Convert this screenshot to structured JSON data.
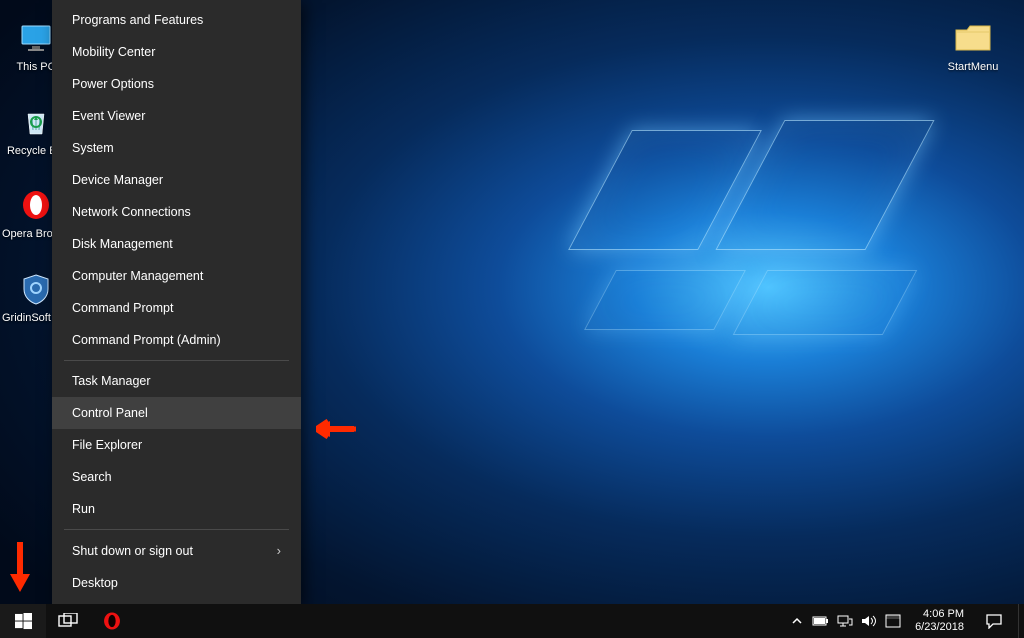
{
  "desktop": {
    "icons_left": [
      {
        "name": "this-pc-icon",
        "label": "This PC",
        "glyph": "pc"
      },
      {
        "name": "recycle-bin-icon",
        "label": "Recycle Bin",
        "glyph": "bin"
      },
      {
        "name": "opera-icon",
        "label": "Opera Browser",
        "glyph": "opera"
      },
      {
        "name": "gridinsoft-icon",
        "label": "GridinSoft Anti-Malware",
        "glyph": "shield"
      }
    ],
    "icons_right": [
      {
        "name": "startmenu-folder-icon",
        "label": "StartMenu",
        "glyph": "folder"
      }
    ]
  },
  "winx_menu": {
    "highlighted": "Control Panel",
    "sections": [
      [
        "Programs and Features",
        "Mobility Center",
        "Power Options",
        "Event Viewer",
        "System",
        "Device Manager",
        "Network Connections",
        "Disk Management",
        "Computer Management",
        "Command Prompt",
        "Command Prompt (Admin)"
      ],
      [
        "Task Manager",
        "Control Panel",
        "File Explorer",
        "Search",
        "Run"
      ],
      [
        {
          "label": "Shut down or sign out",
          "submenu": true
        },
        "Desktop"
      ]
    ]
  },
  "taskbar": {
    "pinned": [
      {
        "name": "task-view-button",
        "glyph": "taskview"
      },
      {
        "name": "opera-taskbar-icon",
        "glyph": "opera"
      }
    ],
    "tray": {
      "icons": [
        {
          "name": "tray-chevron-up-icon",
          "glyph": "chevup"
        },
        {
          "name": "battery-icon",
          "glyph": "battery"
        },
        {
          "name": "network-icon",
          "glyph": "network"
        },
        {
          "name": "volume-icon",
          "glyph": "volume"
        },
        {
          "name": "language-indicator",
          "glyph": "lang"
        }
      ],
      "time": "4:06 PM",
      "date": "6/23/2018"
    }
  }
}
